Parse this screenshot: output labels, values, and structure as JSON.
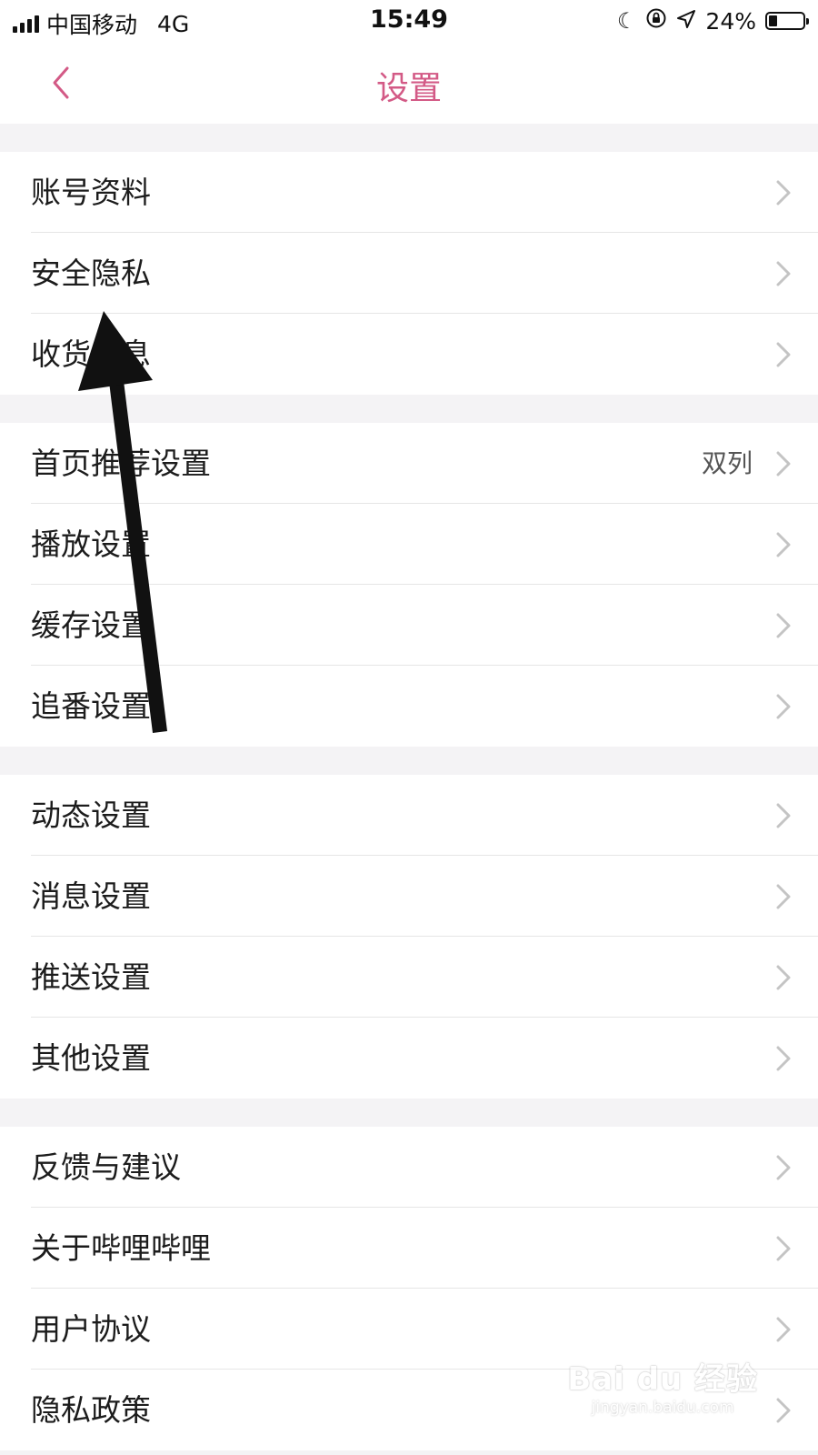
{
  "status_bar": {
    "carrier": "中国移动",
    "network": "4G",
    "time": "15:49",
    "icons": [
      "moon-icon",
      "orientation-lock-icon",
      "location-arrow-icon"
    ],
    "battery_text": "24%",
    "battery_level": 0.24
  },
  "nav": {
    "title": "设置",
    "back_icon": "chevron-left-icon",
    "accent_color": "#d35a86"
  },
  "groups": [
    {
      "items": [
        {
          "label": "账号资料"
        },
        {
          "label": "安全隐私"
        },
        {
          "label": "收货信息"
        }
      ]
    },
    {
      "items": [
        {
          "label": "首页推荐设置",
          "value": "双列"
        },
        {
          "label": "播放设置"
        },
        {
          "label": "缓存设置"
        },
        {
          "label": "追番设置"
        }
      ]
    },
    {
      "items": [
        {
          "label": "动态设置"
        },
        {
          "label": "消息设置"
        },
        {
          "label": "推送设置"
        },
        {
          "label": "其他设置"
        }
      ]
    },
    {
      "items": [
        {
          "label": "反馈与建议"
        },
        {
          "label": "关于哔哩哔哩"
        },
        {
          "label": "用户协议"
        },
        {
          "label": "隐私政策"
        }
      ]
    }
  ],
  "annotation": {
    "type": "arrow",
    "color": "#111111",
    "points_to": "安全隐私"
  },
  "watermark": {
    "logo": "Bai du 经验",
    "url": "jingyan.baidu.com"
  }
}
